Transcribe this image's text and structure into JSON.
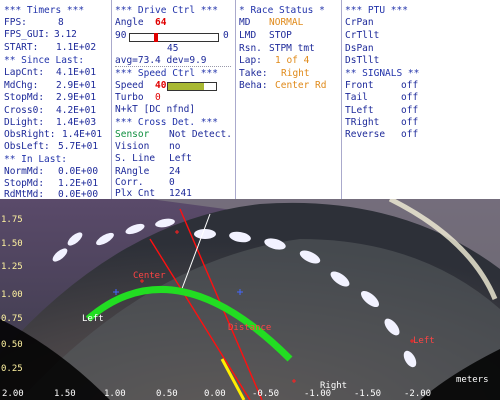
{
  "timers": {
    "header": "*** Timers ***",
    "fps_label": "FPS:",
    "fps": "8",
    "fps_gui_label": "FPS_GUI:",
    "fps_gui": "3.12",
    "start_label": "START:",
    "start": "1.1E+02",
    "since_last_header": "** Since Last:",
    "since_last": [
      {
        "label": "LapCnt:",
        "value": "4.1E+01"
      },
      {
        "label": "MdChg:",
        "value": "2.9E+01"
      },
      {
        "label": "StopMd:",
        "value": "2.9E+01"
      },
      {
        "label": "Cross0:",
        "value": "4.2E+01"
      },
      {
        "label": "DLight:",
        "value": "1.4E+03"
      },
      {
        "label": "ObsRight:",
        "value": "1.4E+01"
      },
      {
        "label": "ObsLeft:",
        "value": "5.7E+01"
      }
    ],
    "in_last_header": "** In Last:",
    "in_last": [
      {
        "label": "NormMd:",
        "value": "0.0E+00"
      },
      {
        "label": "StopMd:",
        "value": "1.2E+01"
      },
      {
        "label": "RdMtMd:",
        "value": "0.0E+00"
      }
    ]
  },
  "drive": {
    "header": "*** Drive Ctrl ***",
    "angle_label": "Angle",
    "angle_value": "64",
    "angle_min": "90",
    "angle_max": "0",
    "angle_fraction": 0.29,
    "angle_center": "45",
    "stats": "avg=73.4 dev=9.9",
    "speed_header": "*** Speed Ctrl ***",
    "speed_label": "Speed",
    "speed_value": "40",
    "speed_fraction": 0.75,
    "turbo_label": "Turbo",
    "turbo_value": "0",
    "nkt": "N+kT [DC nfnd]",
    "cross_header": "*** Cross Det. ***",
    "cross": [
      {
        "label": "Sensor",
        "value": "Not Detect.",
        "label_color": "#109040",
        "value_color": "#1e2a9a"
      },
      {
        "label": "Vision",
        "value": "no"
      },
      {
        "label": "S. Line",
        "value": "Left"
      },
      {
        "label": "RAngle",
        "value": "24"
      },
      {
        "label": "Corr.",
        "value": "0"
      },
      {
        "label": "Plx Cnt",
        "value": "1241"
      }
    ]
  },
  "race": {
    "header": "* Race Status *",
    "md_label": "MD",
    "md_value": "NORMAL",
    "lmd_label": "LMD",
    "lmd_value": "STOP",
    "rsn_label": "Rsn.",
    "rsn_value": "STPM tmt",
    "lap_label": "Lap:",
    "lap_value": "1 of 4",
    "take_label": "Take:",
    "take_value": "Right",
    "beha_label": "Beha:",
    "beha_value": "Center Rd"
  },
  "ptu": {
    "header": "*** PTU ***",
    "items": [
      "CrPan",
      "CrTllt",
      "DsPan",
      "DsTllt"
    ],
    "signals_header": "** SIGNALS **",
    "signals": [
      {
        "label": "Front",
        "value": "off"
      },
      {
        "label": "Tail",
        "value": "off"
      },
      {
        "label": "TLeft",
        "value": "off"
      },
      {
        "label": "TRight",
        "value": "off"
      },
      {
        "label": "Reverse",
        "value": "off"
      }
    ]
  },
  "camera": {
    "y_ticks": [
      "1.75",
      "1.50",
      "1.25",
      "1.00",
      "0.75",
      "0.50",
      "0.25",
      "0.00"
    ],
    "x_ticks": [
      "2.00",
      "1.50",
      "1.00",
      "0.50",
      "0.00",
      "-0.50",
      "-1.00",
      "-1.50",
      "-2.00"
    ],
    "units": "meters",
    "labels": {
      "left": "Left",
      "right": "Right",
      "center": "Center",
      "distance": "Distance",
      "side": "Left"
    },
    "colors": {
      "lane": "#22dd22",
      "marker": "#e00000",
      "heading": "#ffee00",
      "axis_label": "#ffee33"
    }
  }
}
